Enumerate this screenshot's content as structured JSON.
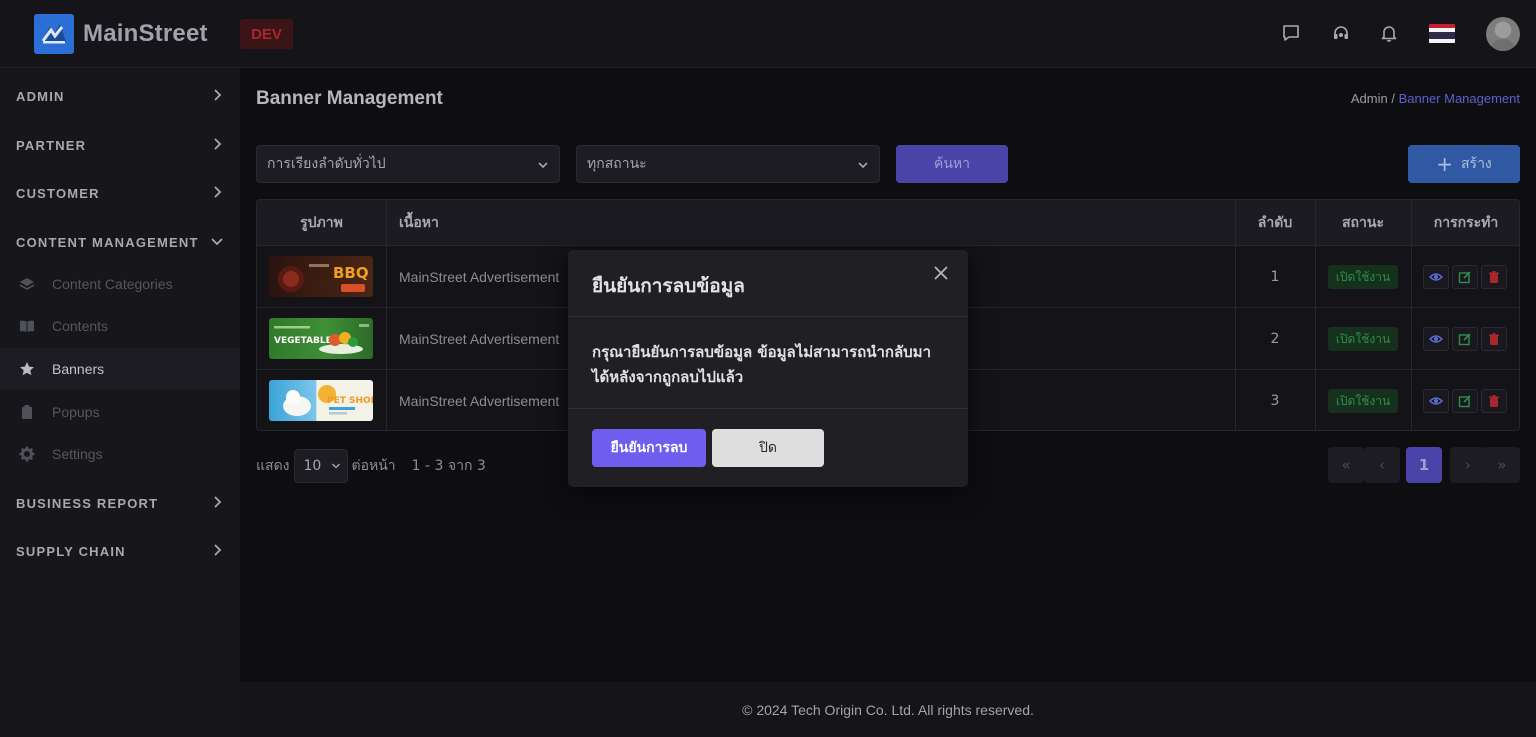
{
  "header": {
    "brand": "MainStreet",
    "env_badge": "DEV"
  },
  "sidebar": {
    "groups": [
      {
        "label": "ADMIN"
      },
      {
        "label": "PARTNER"
      },
      {
        "label": "CUSTOMER"
      },
      {
        "label": "CONTENT MANAGEMENT"
      },
      {
        "label": "BUSINESS REPORT"
      },
      {
        "label": "SUPPLY CHAIN"
      }
    ],
    "content_items": [
      {
        "label": "Content Categories",
        "icon": "layers-icon"
      },
      {
        "label": "Contents",
        "icon": "book-icon"
      },
      {
        "label": "Banners",
        "icon": "star-icon",
        "active": true
      },
      {
        "label": "Popups",
        "icon": "clipboard-icon"
      },
      {
        "label": "Settings",
        "icon": "gear-icon"
      }
    ]
  },
  "page": {
    "title": "Banner Management",
    "breadcrumb": {
      "root": "Admin",
      "separator": " / ",
      "current": "Banner Management"
    }
  },
  "filters": {
    "sort_value": "การเรียงลำดับทั่วไป",
    "status_value": "ทุกสถานะ",
    "search_label": "ค้นหา",
    "create_label": "สร้าง"
  },
  "table": {
    "headers": {
      "image": "รูปภาพ",
      "content": "เนื้อหา",
      "order": "ลำดับ",
      "status": "สถานะ",
      "actions": "การกระทำ"
    },
    "rows": [
      {
        "content": "MainStreet Advertisement",
        "order": "1",
        "status": "เปิดใช้งาน",
        "thumb": "BBQ"
      },
      {
        "content": "MainStreet Advertisement",
        "order": "2",
        "status": "เปิดใช้งาน",
        "thumb": "VEGETABLE"
      },
      {
        "content": "MainStreet Advertisement",
        "order": "3",
        "status": "เปิดใช้งาน",
        "thumb": "PET SHOP"
      }
    ]
  },
  "pagination": {
    "show_label": "แสดง",
    "per_page": "10",
    "per_page_suffix": "ต่อหน้า",
    "range": "1 - 3 จาก 3",
    "current_page": "1",
    "first": "«",
    "prev": "‹",
    "next": "›",
    "last": "»"
  },
  "modal": {
    "title": "ยืนยันการลบข้อมูล",
    "body_line1": "กรุณายืนยันการลบข้อมูล ข้อมูลไม่สามารถนำกลับมา",
    "body_line2": "ได้หลังจากถูกลบไปแล้ว",
    "confirm_label": "ยืนยันการลบ",
    "close_label": "ปิด"
  },
  "footer": {
    "copyright": "© 2024 Tech Origin Co. Ltd. All rights reserved."
  },
  "colors": {
    "accent": "#6d5ef0",
    "brand_blue": "#2b6fd6",
    "status_green": "#2f8f49",
    "danger": "#c0392b"
  }
}
